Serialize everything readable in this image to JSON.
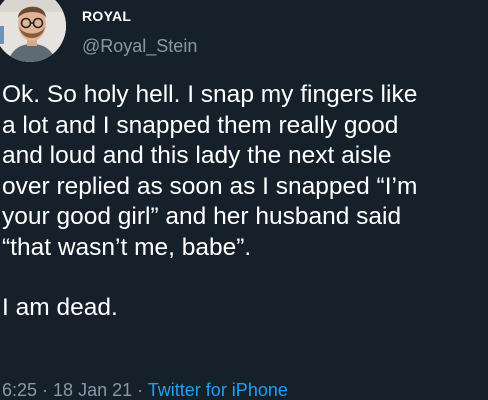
{
  "author": {
    "display_name": "ROYAL",
    "handle": "@Royal_Stein"
  },
  "tweet": {
    "paragraph_1": "Ok. So holy hell. I snap my fingers like\na lot and I snapped them really good\nand loud and this lady the next aisle\nover replied as soon as I snapped “I’m\nyour good girl” and her husband said\n“that wasn’t me, babe”.",
    "paragraph_2": "I am dead."
  },
  "meta": {
    "time": "6:25",
    "separator": " · ",
    "date": "18 Jan 21",
    "source": "Twitter for iPhone"
  },
  "colors": {
    "background": "#15202b",
    "text": "#ffffff",
    "secondary": "#8899a6",
    "link": "#1da1f2"
  }
}
